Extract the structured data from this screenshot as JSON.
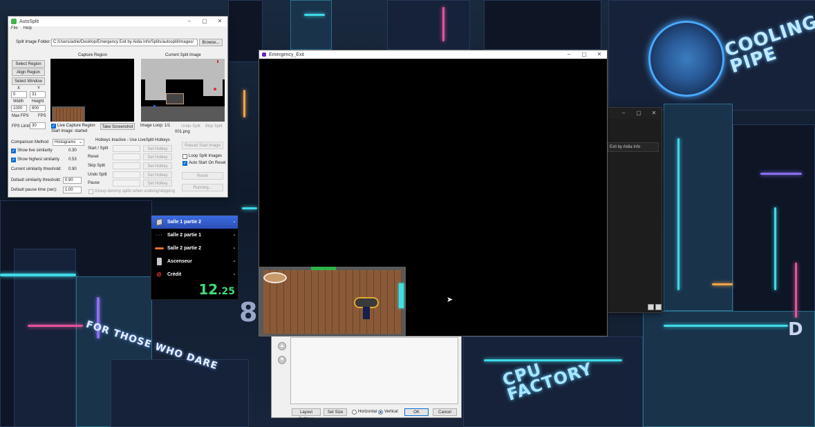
{
  "autosplit": {
    "title": "AutoSplit",
    "menu": [
      "File",
      "Help"
    ],
    "split_folder_label": "Split Image Folder:",
    "split_folder_path": "C:/Users/adrie/Desktop/Emergency Exit by Aidia Info/Splits/autosplit/images/",
    "browse_label": "Browse...",
    "capture_region_label": "Capture Region",
    "current_split_label": "Current Split Image",
    "select_region": "Select Region",
    "align_region": "Align Region",
    "select_window": "Select Window",
    "x_label": "X",
    "y_label": "Y",
    "x_value": "0",
    "y_value": "31",
    "width_label": "Width",
    "height_label": "Height",
    "width_value": "1000",
    "height_value": "800",
    "max_fps_label": "Max FPS",
    "fps_label": "FPS",
    "fps_limit_label": "FPS Limit:",
    "fps_limit_value": "30",
    "live_capture_label": "Live Capture Region",
    "take_screenshot": "Take Screenshot",
    "start_image_status": "Start image: started",
    "image_loop": "Image Loop: 1/1",
    "image_name": "001.png",
    "undo_split": "Undo Split",
    "skip_split": "Skip Split",
    "comparison_method_label": "Comparison Method",
    "comparison_method_value": "Histograms",
    "show_live_similarity": "Show live similarity",
    "live_similarity_value": "0.30",
    "show_highest_similarity": "Show highest similarity",
    "highest_similarity_value": "0.53",
    "current_threshold_label": "Current similarity threshold:",
    "current_threshold_value": "0.90",
    "default_threshold_label": "Default similarity threshold:",
    "default_threshold_value": "0.90",
    "default_pause_label": "Default pause time (sec):",
    "default_pause_value": "1.00",
    "hotkeys_header": "Hotkeys Inactive - Use LiveSplit Hotkeys",
    "hotkeys": [
      "Start / Split",
      "Reset",
      "Skip Split",
      "Undo Split",
      "Pause"
    ],
    "set_hotkey": "Set Hotkey",
    "group_dummy": "Group dummy splits when undoing/skipping",
    "reload_start_image": "Reload Start Image",
    "loop_split_images": "Loop Split Images",
    "auto_start_on_reset": "Auto Start On Reset",
    "reset_button": "Reset",
    "running_button": "Running..."
  },
  "livesplit": {
    "splits": [
      {
        "icon": "cube-icon",
        "name": "Salle 1 partie 2",
        "delta": "-"
      },
      {
        "icon": "dots-icon",
        "name": "Salle 2 partie 1",
        "delta": "-"
      },
      {
        "icon": "key-icon",
        "name": "Salle 2 partie 2",
        "delta": "-"
      },
      {
        "icon": "trash-can-icon",
        "name": "Ascenseur",
        "delta": "-"
      },
      {
        "icon": "no-entry-icon",
        "name": "Crédit",
        "delta": "-"
      }
    ],
    "timer_main": "12",
    "timer_fraction": ".25",
    "colors": {
      "active_row": "#3563d6",
      "timer": "#3fdc7b"
    }
  },
  "game_window": {
    "title": "Emergency_Exit"
  },
  "background_window": {
    "partial_text": "Exit by Aidia Info"
  },
  "layout_editor": {
    "layout_settings": "Layout Settings",
    "set_size": "Set Size",
    "horizontal": "Horizontal",
    "vertical": "Vertical",
    "ok": "OK",
    "cancel": "Cancel"
  },
  "wallpaper": {
    "sign_cooling": "COOLING\nPIPE",
    "sign_dare": "FOR THOSE WHO DARE",
    "sign_cpu": "CPU\nFACTORY",
    "sign_eight": "8",
    "sign_dt": "D"
  }
}
